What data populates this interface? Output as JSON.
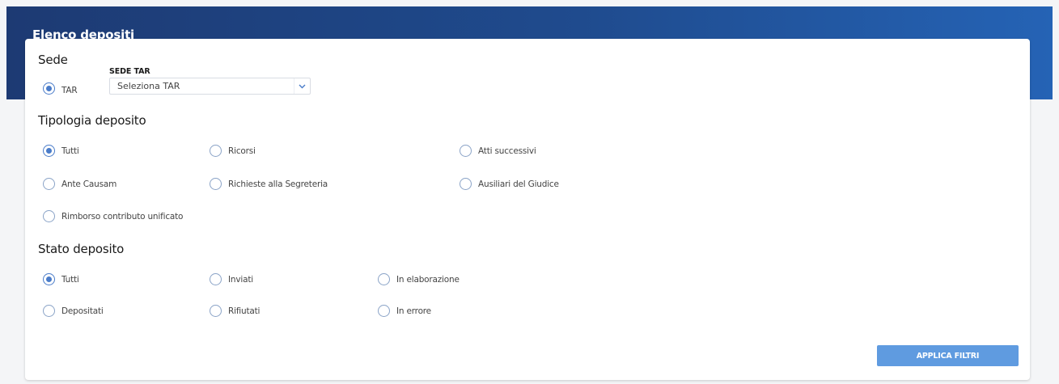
{
  "header": {
    "title": "Elenco depositi"
  },
  "sede": {
    "title": "Sede",
    "radio_label": "TAR",
    "field_label": "SEDE TAR",
    "select_value": "Seleziona TAR"
  },
  "tipologia": {
    "title": "Tipologia deposito",
    "options": [
      "Tutti",
      "Ricorsi",
      "Atti successivi",
      "Ante Causam",
      "Richieste alla Segreteria",
      "Ausiliari del Giudice",
      "Rimborso contributo unificato"
    ],
    "selected": "Tutti"
  },
  "stato": {
    "title": "Stato deposito",
    "options": [
      "Tutti",
      "Inviati",
      "In elaborazione",
      "Depositati",
      "Rifiutati",
      "In errore"
    ],
    "selected": "Tutti"
  },
  "actions": {
    "apply_label": "APPLICA FILTRI"
  },
  "colors": {
    "header_start": "#1d3a73",
    "header_end": "#2563b5",
    "accent": "#4a7cc9",
    "button": "#5f9be0"
  },
  "icons": {
    "select_arrow": "chevron-down-icon"
  }
}
